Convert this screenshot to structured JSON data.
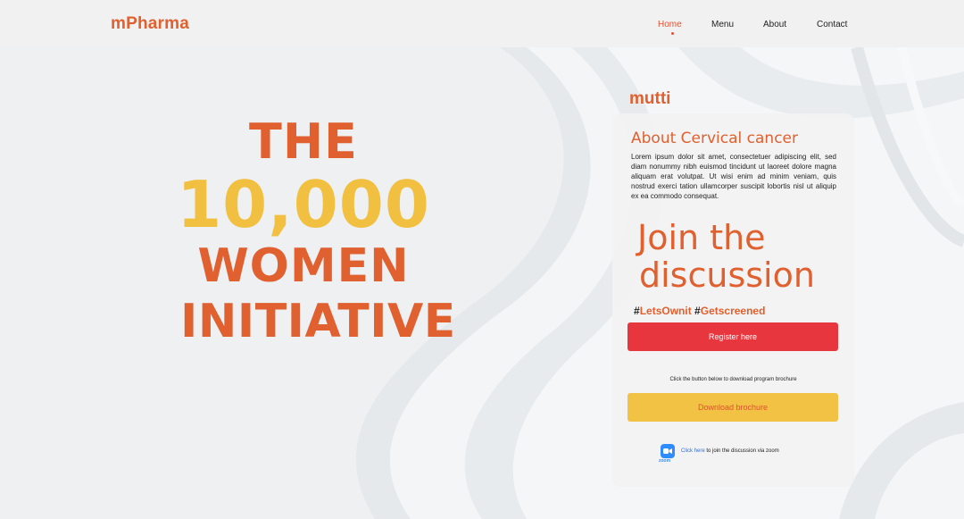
{
  "nav": {
    "brand": "mPharma",
    "links": [
      {
        "label": "Home",
        "active": true
      },
      {
        "label": "Menu",
        "active": false
      },
      {
        "label": "About",
        "active": false
      },
      {
        "label": "Contact",
        "active": false
      }
    ]
  },
  "hero": {
    "line1": "THE",
    "line2": "10,000",
    "line3": "WOMEN",
    "line4": "INITIATIVE"
  },
  "sidebar": {
    "brand": "mutti",
    "heading": "About Cervical cancer",
    "body": "Lorem ipsum dolor sit amet, consectetuer adipiscing elit, sed diam nonummy nibh euismod tincidunt ut laoreet dolore magna aliquam erat volutpat. Ut wisi enim ad minim veniam, quis nostrud exerci tation ullamcorper suscipit lobortis nisl ut aliquip ex ea commodo consequat.",
    "join_line1": "Join the",
    "join_line2": "discussion",
    "hash": "#",
    "tag1": "LetsOwnit",
    "tag2": "Getscreened",
    "register_label": "Register here",
    "download_hint": "Click the button below to download program brochure",
    "download_label": "Download brochure",
    "zoom_icon_label": "zoom",
    "zoom_link": "Click here",
    "zoom_text": " to join the discussion via zoom"
  },
  "colors": {
    "brand_orange": "#e0602f",
    "accent_yellow": "#f2c041",
    "button_red": "#e8363f",
    "zoom_blue": "#2d8cff"
  },
  "icons": {
    "zoom": "zoom-icon"
  }
}
